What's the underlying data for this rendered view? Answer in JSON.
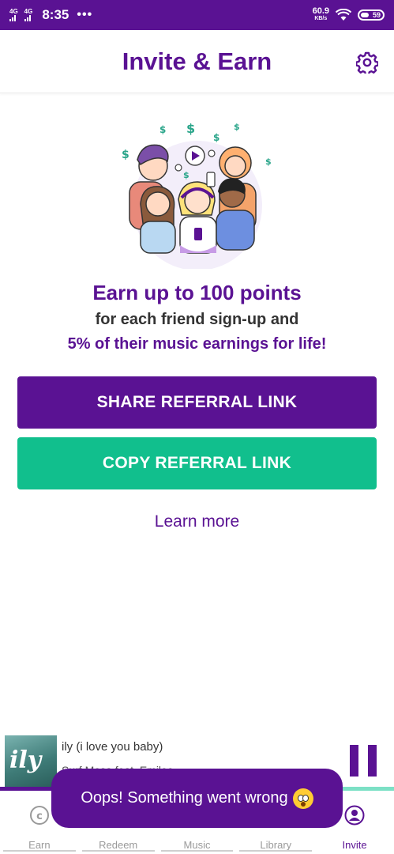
{
  "status_bar": {
    "network_1": "4G",
    "network_2": "4G",
    "time": "8:35",
    "more": "•••",
    "speed_value": "60.9",
    "speed_unit": "KB/s",
    "battery": "59"
  },
  "header": {
    "title": "Invite & Earn",
    "settings_icon": "gear-icon"
  },
  "content": {
    "headline": "Earn up to 100 points",
    "subline_1": "for each friend sign-up and",
    "subline_2": "5% of their music earnings for life!",
    "share_button": "SHARE REFERRAL LINK",
    "copy_button": "COPY REFERRAL LINK",
    "learn_more": "Learn more"
  },
  "player": {
    "album_art_text": "ily",
    "track_title": "ily (i love you baby)",
    "track_artist": "Surf Mesa feat. Emilee",
    "progress": 0.15
  },
  "bottom_nav": [
    {
      "label": "Earn",
      "icon": "coin-icon",
      "active": false
    },
    {
      "label": "Redeem",
      "icon": "gift-icon",
      "active": false
    },
    {
      "label": "Music",
      "icon": "music-icon",
      "active": false
    },
    {
      "label": "Library",
      "icon": "library-icon",
      "active": false
    },
    {
      "label": "Invite",
      "icon": "invite-icon",
      "active": true
    }
  ],
  "toast": {
    "message": "Oops! Something went wrong",
    "emoji": "flushed-face-emoji"
  },
  "colors": {
    "brand_purple": "#5a1293",
    "accent_green": "#11bf8d"
  }
}
